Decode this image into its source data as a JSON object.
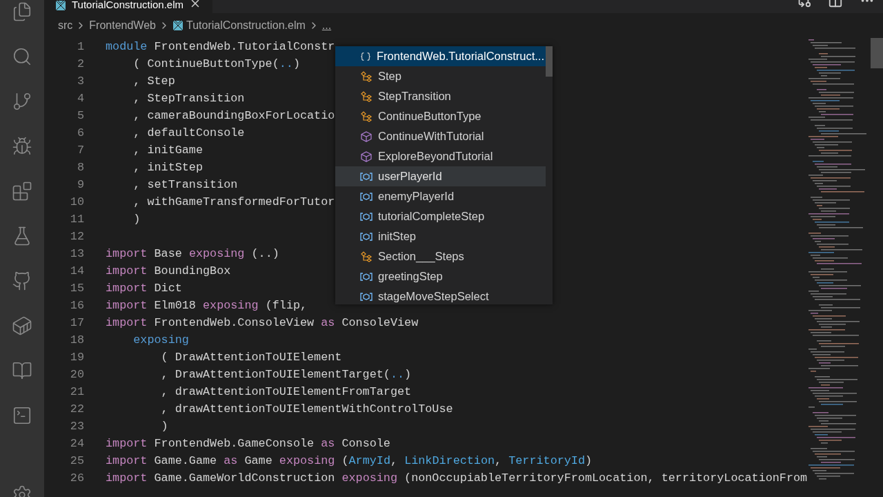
{
  "tab": {
    "title": "TutorialConstruction.elm",
    "selected": true
  },
  "breadcrumb": [
    "src",
    "FrontendWeb",
    "TutorialConstruction.elm",
    "..."
  ],
  "editor": {
    "lines": [
      {
        "number": "1",
        "tokens": [
          {
            "t": "module",
            "color": "#569cd6"
          },
          {
            "t": " FrontendWeb.TutorialConstr",
            "color": "#d4d4d4"
          }
        ]
      },
      {
        "number": "2",
        "tokens": [
          {
            "t": "    ( ContinueButtonType(",
            "color": "#d4d4d4"
          },
          {
            "t": "..",
            "color": "#569cd6"
          },
          {
            "t": ")",
            "color": "#d4d4d4"
          }
        ]
      },
      {
        "number": "3",
        "tokens": [
          {
            "t": "    , Step",
            "color": "#d4d4d4"
          }
        ]
      },
      {
        "number": "4",
        "tokens": [
          {
            "t": "    , StepTransition",
            "color": "#d4d4d4"
          }
        ]
      },
      {
        "number": "5",
        "tokens": [
          {
            "t": "    , cameraBoundingBoxForLocatio",
            "color": "#d4d4d4"
          }
        ]
      },
      {
        "number": "6",
        "tokens": [
          {
            "t": "    , defaultConsole",
            "color": "#d4d4d4"
          }
        ]
      },
      {
        "number": "7",
        "tokens": [
          {
            "t": "    , initGame",
            "color": "#d4d4d4"
          }
        ]
      },
      {
        "number": "8",
        "tokens": [
          {
            "t": "    , initStep",
            "color": "#d4d4d4"
          }
        ]
      },
      {
        "number": "9",
        "tokens": [
          {
            "t": "    , setTransition",
            "color": "#d4d4d4"
          }
        ]
      },
      {
        "number": "10",
        "tokens": [
          {
            "t": "    , withGameTransformedForTutor",
            "color": "#d4d4d4"
          }
        ]
      },
      {
        "number": "11",
        "tokens": [
          {
            "t": "    )",
            "color": "#d4d4d4"
          }
        ]
      },
      {
        "number": "12"
      },
      {
        "number": "13",
        "tokens": [
          {
            "t": "import",
            "color": "#c586c0"
          },
          {
            "t": " Base ",
            "color": "#d4d4d4"
          },
          {
            "t": "exposing",
            "color": "#c586c0"
          },
          {
            "t": " (..)",
            "color": "#d4d4d4"
          }
        ]
      },
      {
        "number": "14",
        "tokens": [
          {
            "t": "import",
            "color": "#c586c0"
          },
          {
            "t": " BoundingBox",
            "color": "#d4d4d4"
          }
        ]
      },
      {
        "number": "15",
        "tokens": [
          {
            "t": "import",
            "color": "#c586c0"
          },
          {
            "t": " Dict",
            "color": "#d4d4d4"
          }
        ]
      },
      {
        "number": "16",
        "tokens": [
          {
            "t": "import",
            "color": "#c586c0"
          },
          {
            "t": " Elm018 ",
            "color": "#d4d4d4"
          },
          {
            "t": "exposing",
            "color": "#c586c0"
          },
          {
            "t": " (flip,",
            "color": "#d4d4d4"
          }
        ]
      },
      {
        "number": "17",
        "tokens": [
          {
            "t": "import",
            "color": "#c586c0"
          },
          {
            "t": " FrontendWeb.ConsoleView ",
            "color": "#d4d4d4"
          },
          {
            "t": "as",
            "color": "#c586c0"
          },
          {
            "t": " ConsoleView",
            "color": "#d4d4d4"
          }
        ]
      },
      {
        "number": "18",
        "tokens": [
          {
            "t": "    exposing",
            "color": "#569cd6"
          }
        ]
      },
      {
        "number": "19",
        "tokens": [
          {
            "t": "        ( DrawAttentionToUIElement",
            "color": "#d4d4d4"
          }
        ]
      },
      {
        "number": "20",
        "tokens": [
          {
            "t": "        , DrawAttentionToUIElementTarget(",
            "color": "#d4d4d4"
          },
          {
            "t": "..",
            "color": "#569cd6"
          },
          {
            "t": ")",
            "color": "#d4d4d4"
          }
        ]
      },
      {
        "number": "21",
        "tokens": [
          {
            "t": "        , drawAttentionToUIElementFromTarget",
            "color": "#d4d4d4"
          }
        ]
      },
      {
        "number": "22",
        "tokens": [
          {
            "t": "        , drawAttentionToUIElementWithControlToUse",
            "color": "#d4d4d4"
          }
        ]
      },
      {
        "number": "23",
        "tokens": [
          {
            "t": "        )",
            "color": "#d4d4d4"
          }
        ]
      },
      {
        "number": "24",
        "tokens": [
          {
            "t": "import",
            "color": "#c586c0"
          },
          {
            "t": " FrontendWeb.GameConsole ",
            "color": "#d4d4d4"
          },
          {
            "t": "as",
            "color": "#c586c0"
          },
          {
            "t": " Console",
            "color": "#d4d4d4"
          }
        ]
      },
      {
        "number": "25",
        "tokens": [
          {
            "t": "import",
            "color": "#c586c0"
          },
          {
            "t": " Game.Game ",
            "color": "#d4d4d4"
          },
          {
            "t": "as",
            "color": "#c586c0"
          },
          {
            "t": " Game ",
            "color": "#d4d4d4"
          },
          {
            "t": "exposing",
            "color": "#c586c0"
          },
          {
            "t": " (",
            "color": "#d4d4d4"
          },
          {
            "t": "ArmyId",
            "color": "#4fa8e0"
          },
          {
            "t": ", ",
            "color": "#d4d4d4"
          },
          {
            "t": "LinkDirection",
            "color": "#4fa8e0"
          },
          {
            "t": ", ",
            "color": "#d4d4d4"
          },
          {
            "t": "TerritoryId",
            "color": "#4fa8e0"
          },
          {
            "t": ")",
            "color": "#d4d4d4"
          }
        ]
      },
      {
        "number": "26",
        "tokens": [
          {
            "t": "import",
            "color": "#c586c0"
          },
          {
            "t": " Game.GameWorldConstruction ",
            "color": "#d4d4d4"
          },
          {
            "t": "exposing",
            "color": "#c586c0"
          },
          {
            "t": " (nonOccupiableTerritoryFromLocation, territoryLocationFrom",
            "color": "#d4d4d4"
          }
        ]
      }
    ]
  },
  "suggestions": [
    {
      "label": "FrontendWeb.TutorialConstruct...",
      "kind": "module",
      "selected": true,
      "hovered": false
    },
    {
      "label": "Step",
      "kind": "type",
      "selected": false,
      "hovered": false
    },
    {
      "label": "StepTransition",
      "kind": "type",
      "selected": false,
      "hovered": false
    },
    {
      "label": "ContinueButtonType",
      "kind": "type",
      "selected": false,
      "hovered": false
    },
    {
      "label": "ContinueWithTutorial",
      "kind": "constructor",
      "selected": false,
      "hovered": false
    },
    {
      "label": "ExploreBeyondTutorial",
      "kind": "constructor",
      "selected": false,
      "hovered": false
    },
    {
      "label": "userPlayerId",
      "kind": "value",
      "selected": false,
      "hovered": true
    },
    {
      "label": "enemyPlayerId",
      "kind": "value",
      "selected": false,
      "hovered": false
    },
    {
      "label": "tutorialCompleteStep",
      "kind": "value",
      "selected": false,
      "hovered": false
    },
    {
      "label": "initStep",
      "kind": "value",
      "selected": false,
      "hovered": false
    },
    {
      "label": "Section___Steps",
      "kind": "type",
      "selected": false,
      "hovered": false
    },
    {
      "label": "greetingStep",
      "kind": "value",
      "selected": false,
      "hovered": false
    },
    {
      "label": "stageMoveStepSelect",
      "kind": "value",
      "selected": false,
      "hovered": false
    }
  ]
}
